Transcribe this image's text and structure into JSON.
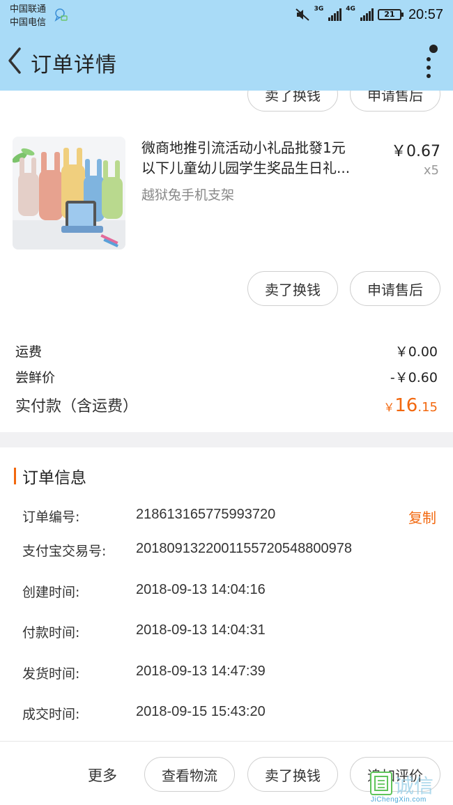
{
  "status_bar": {
    "carrier_1": "中国联通",
    "carrier_2": "中国电信",
    "net_1": "3G",
    "net_2": "4G",
    "battery": "21",
    "time": "20:57"
  },
  "nav": {
    "title": "订单详情"
  },
  "prev_item_actions": {
    "sell_label": "卖了换钱",
    "after_sale_label": "申请售后"
  },
  "product": {
    "title_line1": "微商地推引流活动小礼品批發1元",
    "title_line2": "以下儿童幼儿园学生奖品生日礼...",
    "spec": "越狱兔手机支架",
    "price": "￥0.67",
    "quantity": "x5",
    "sell_label": "卖了换钱",
    "after_sale_label": "申请售后"
  },
  "fees": {
    "shipping_label": "运费",
    "shipping_value": "￥0.00",
    "trial_label": "尝鲜价",
    "trial_value": "-￥0.60",
    "total_label": "实付款（含运费）",
    "total_currency": "￥",
    "total_int": "16",
    "total_dec": ".15"
  },
  "order_info": {
    "section_title": "订单信息",
    "copy_label": "复制",
    "rows": [
      {
        "label": "订单编号:",
        "value": "218613165775993720"
      },
      {
        "label": "支付宝交易号:",
        "value": "2018091322001155720548800978"
      },
      {
        "label": "创建时间:",
        "value": "2018-09-13 14:04:16"
      },
      {
        "label": "付款时间:",
        "value": "2018-09-13 14:04:31"
      },
      {
        "label": "发货时间:",
        "value": "2018-09-13 14:47:39"
      },
      {
        "label": "成交时间:",
        "value": "2018-09-15 15:43:20"
      }
    ]
  },
  "bottom_bar": {
    "more_label": "更多",
    "logistics_label": "查看物流",
    "sell_label": "卖了换钱",
    "review_label": "追加评价"
  },
  "watermark": {
    "text": "诚信",
    "sub": "JiChengXin.com"
  },
  "colors": {
    "header_bg": "#a9dbf7",
    "accent": "#f2680f"
  }
}
